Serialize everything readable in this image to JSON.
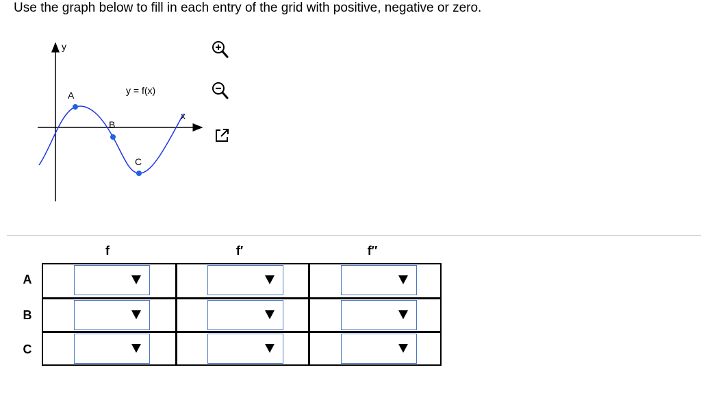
{
  "question": "Use the graph below to fill in each entry of the grid with positive, negative or zero.",
  "graph": {
    "y_axis_label": "y",
    "x_axis_label": "x",
    "curve_label": "y = f(x)",
    "points": [
      {
        "label": "A"
      },
      {
        "label": "B"
      },
      {
        "label": "C"
      }
    ],
    "curve_color": "#1f35e8",
    "point_color": "#1f63e0"
  },
  "tools": {
    "zoom_in_icon": "zoom-in-magnifier",
    "zoom_out_icon": "zoom-out-magnifier",
    "popout_icon": "external-window"
  },
  "table": {
    "columns": [
      "f",
      "f′",
      "f′′"
    ],
    "rows": [
      "A",
      "B",
      "C"
    ],
    "cells": [
      [
        "",
        "",
        ""
      ],
      [
        "",
        "",
        ""
      ],
      [
        "",
        "",
        ""
      ]
    ]
  },
  "colors": {
    "dropdown_border": "#4a77c9",
    "divider": "#c8c8d2"
  }
}
